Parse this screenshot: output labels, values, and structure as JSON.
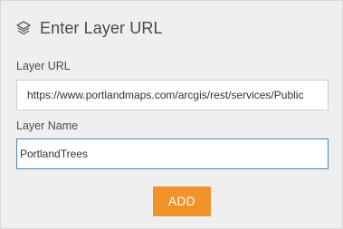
{
  "header": {
    "title": "Enter Layer URL",
    "icon": "layers-icon"
  },
  "form": {
    "url_label": "Layer URL",
    "url_value": "https://www.portlandmaps.com/arcgis/rest/services/Public",
    "name_label": "Layer Name",
    "name_value": "PortlandTrees",
    "add_label": "ADD"
  },
  "colors": {
    "panel_background": "#efefef",
    "accent_button": "#f0932b",
    "focus_border": "#4b87b9",
    "title_text": "#4a4a4a"
  }
}
